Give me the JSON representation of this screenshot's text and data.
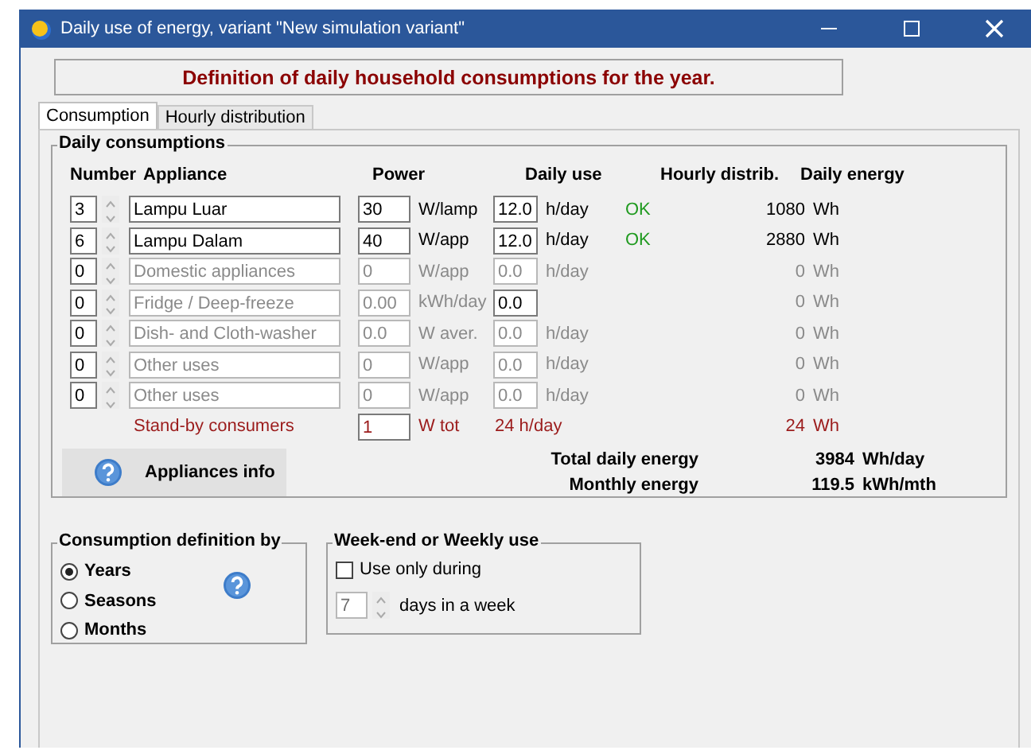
{
  "window": {
    "title": "Daily use of energy, variant \"New simulation variant\""
  },
  "heading": "Definition of daily household consumptions for the year.",
  "tabs": [
    {
      "label": "Consumption",
      "selected": true
    },
    {
      "label": "Hourly distribution",
      "selected": false
    }
  ],
  "daily_consumptions": {
    "title": "Daily consumptions",
    "columns": [
      "Number",
      "Appliance",
      "Power",
      "Daily use",
      "Hourly distrib.",
      "Daily energy"
    ],
    "rows": [
      {
        "number": "3",
        "appliance": "Lampu Luar",
        "power": "30",
        "power_unit": "W/lamp",
        "daily_use": "12.0",
        "daily_use_unit": "h/day",
        "hourly_distrib": "OK",
        "energy": "1080",
        "energy_unit": "Wh",
        "disabled": false,
        "daily_use_disabled": false
      },
      {
        "number": "6",
        "appliance": "Lampu Dalam",
        "power": "40",
        "power_unit": "W/app",
        "daily_use": "12.0",
        "daily_use_unit": "h/day",
        "hourly_distrib": "OK",
        "energy": "2880",
        "energy_unit": "Wh",
        "disabled": false,
        "daily_use_disabled": false
      },
      {
        "number": "0",
        "appliance": "Domestic appliances",
        "power": "0",
        "power_unit": "W/app",
        "daily_use": "0.0",
        "daily_use_unit": "h/day",
        "energy": "0",
        "energy_unit": "Wh",
        "disabled": true,
        "daily_use_disabled": true
      },
      {
        "number": "0",
        "appliance": "Fridge / Deep-freeze",
        "power": "0.00",
        "power_unit": "kWh/day",
        "daily_use": "0.0",
        "energy": "0",
        "energy_unit": "Wh",
        "disabled": true,
        "daily_use_disabled": false
      },
      {
        "number": "0",
        "appliance": "Dish- and Cloth-washer",
        "power": "0.0",
        "power_unit": "W aver.",
        "daily_use": "0.0",
        "daily_use_unit": "h/day",
        "energy": "0",
        "energy_unit": "Wh",
        "disabled": true,
        "daily_use_disabled": true
      },
      {
        "number": "0",
        "appliance": "Other uses",
        "power": "0",
        "power_unit": "W/app",
        "daily_use": "0.0",
        "daily_use_unit": "h/day",
        "energy": "0",
        "energy_unit": "Wh",
        "disabled": true,
        "daily_use_disabled": true
      },
      {
        "number": "0",
        "appliance": "Other uses",
        "power": "0",
        "power_unit": "W/app",
        "daily_use": "0.0",
        "daily_use_unit": "h/day",
        "energy": "0",
        "energy_unit": "Wh",
        "disabled": true,
        "daily_use_disabled": true
      }
    ],
    "standby": {
      "label": "Stand-by consumers",
      "power": "1",
      "power_unit": "W tot",
      "daily_use": "24 h/day",
      "energy": "24",
      "energy_unit": "Wh"
    },
    "info_button": "Appliances info",
    "totals": [
      {
        "label": "Total daily energy",
        "value": "3984",
        "unit": "Wh/day"
      },
      {
        "label": "Monthly energy",
        "value": "119.5",
        "unit": "kWh/mth"
      }
    ]
  },
  "definition_by": {
    "title": "Consumption definition by",
    "options": [
      {
        "label": "Years",
        "selected": true
      },
      {
        "label": "Seasons",
        "selected": false
      },
      {
        "label": "Months",
        "selected": false
      }
    ]
  },
  "weekly_use": {
    "title": "Week-end or Weekly use",
    "checkbox": {
      "label": "Use only during",
      "checked": false
    },
    "days": {
      "value": "7",
      "disabled": true
    },
    "days_label": "days in a week"
  }
}
